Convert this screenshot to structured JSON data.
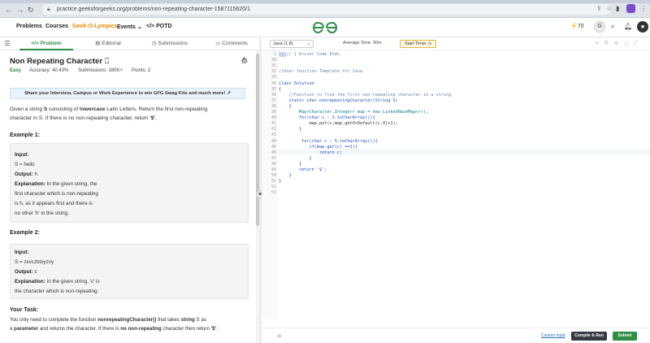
{
  "browser": {
    "url": "practice.geeksforgeeks.org/problems/non-repeating-character-1587115620/1"
  },
  "header": {
    "nav": [
      "Problems",
      "Courses",
      "Geek-O-Lympics",
      "Events",
      "POTD"
    ],
    "streak_count": "70",
    "colors": {
      "brand": "#2f8d46",
      "accent": "#e58a00"
    }
  },
  "tabs": [
    "Problem",
    "Editorial",
    "Submissions",
    "Comments"
  ],
  "problem": {
    "title": "Non Repeating Character",
    "difficulty": "Easy",
    "accuracy": "Accuracy: 40.43%",
    "submissions": "Submissions: 180K+",
    "points": "Points: 2",
    "banner": "Share your Interview, Campus or Work Experience to win GFG Swag Kits and much more!",
    "desc_1": "Given a string ",
    "desc_s": "S",
    "desc_2": " consisting of ",
    "desc_lower": "lowercase",
    "desc_3": " Latin Letters. Return the first non-repeating",
    "desc_4": "character in S. If there is no non-repeating character, return ",
    "desc_dollar": "'$'",
    "desc_end": ".",
    "example1": {
      "heading": "Example 1:",
      "input_label": "Input:",
      "input_value": "S = hello",
      "output_label": "Output:",
      "output_value": " h",
      "explanation_label": "Explanation:",
      "explanation_lines": [
        " In the given string, the",
        "first character which is non-repeating",
        "is h, as it appears first and there is",
        "no other 'h' in the string."
      ]
    },
    "example2": {
      "heading": "Example 2:",
      "input_label": "Input:",
      "input_value": "S = zxvczbtxyzvy",
      "output_label": "Output:",
      "output_value": " c",
      "explanation_label": "Explanation:",
      "explanation_lines": [
        " In the given string, 'c' is",
        "the character which is non-repeating."
      ]
    },
    "task": {
      "heading": "Your Task:",
      "line1_a": "You only need to complete the function ",
      "line1_fn": "nonrepeatingCharacter()",
      "line1_b": " that takes ",
      "line1_s": "string",
      "line1_c": " S as",
      "line2_a": "a ",
      "line2_param": "parameter",
      "line2_b": " and returns the character. If there is ",
      "line2_nonrep": "no non-repeating",
      "line2_c": " character then return ",
      "line2_dollar": "'$'",
      "line2_d": " ."
    }
  },
  "editor": {
    "language": "Java (1.8)",
    "avg_time": "Average Time: 30m",
    "timer_label": "Start Timer",
    "lines": [
      {
        "n": "1",
        "t": "// } Driver Code Ends",
        "c": "cm",
        "hl": "..."
      },
      {
        "n": "30",
        "t": "",
        "c": ""
      },
      {
        "n": "31",
        "t": "",
        "c": ""
      },
      {
        "n": "32",
        "t": "//User function Template for Java",
        "c": "cm"
      },
      {
        "n": "33",
        "t": "",
        "c": ""
      },
      {
        "n": "34",
        "t": "class Solution",
        "c": "kw"
      },
      {
        "n": "35",
        "t": "{",
        "c": ""
      },
      {
        "n": "36",
        "t": "    //Function to find the first non-repeating character in a string.",
        "c": "cm"
      },
      {
        "n": "37",
        "t": "    static char nonrepeatingCharacter(String S)",
        "c": "kw"
      },
      {
        "n": "38",
        "t": "    {",
        "c": ""
      },
      {
        "n": "39",
        "t": "        Map<Character,Integer> map = new LinkedHashMap<>();",
        "c": "ty"
      },
      {
        "n": "40",
        "t": "        for(char c : S.toCharArray()){",
        "c": "kw"
      },
      {
        "n": "41",
        "t": "            map.put(c,map.getOrDefault(c,0)+1);",
        "c": ""
      },
      {
        "n": "42",
        "t": "        }",
        "c": ""
      },
      {
        "n": "43",
        "t": "",
        "c": ""
      },
      {
        "n": "44",
        "t": "         for(char c : S.toCharArray()){",
        "c": "kw"
      },
      {
        "n": "45",
        "t": "            if(map.get(c) ==1){",
        "c": "kw"
      },
      {
        "n": "46",
        "t": "                return c;",
        "c": "kw"
      },
      {
        "n": "47",
        "t": "            }",
        "c": ""
      },
      {
        "n": "48",
        "t": "        }",
        "c": ""
      },
      {
        "n": "49",
        "t": "        return '$';",
        "c": "kw"
      },
      {
        "n": "50",
        "t": "    }",
        "c": ""
      },
      {
        "n": "51",
        "t": "}",
        "c": ""
      },
      {
        "n": "52",
        "t": "",
        "c": ""
      },
      {
        "n": "53",
        "t": "",
        "c": ""
      }
    ],
    "custom_input": "Custom Input",
    "compile_label": "Compile & Run",
    "submit_label": "Submit"
  }
}
